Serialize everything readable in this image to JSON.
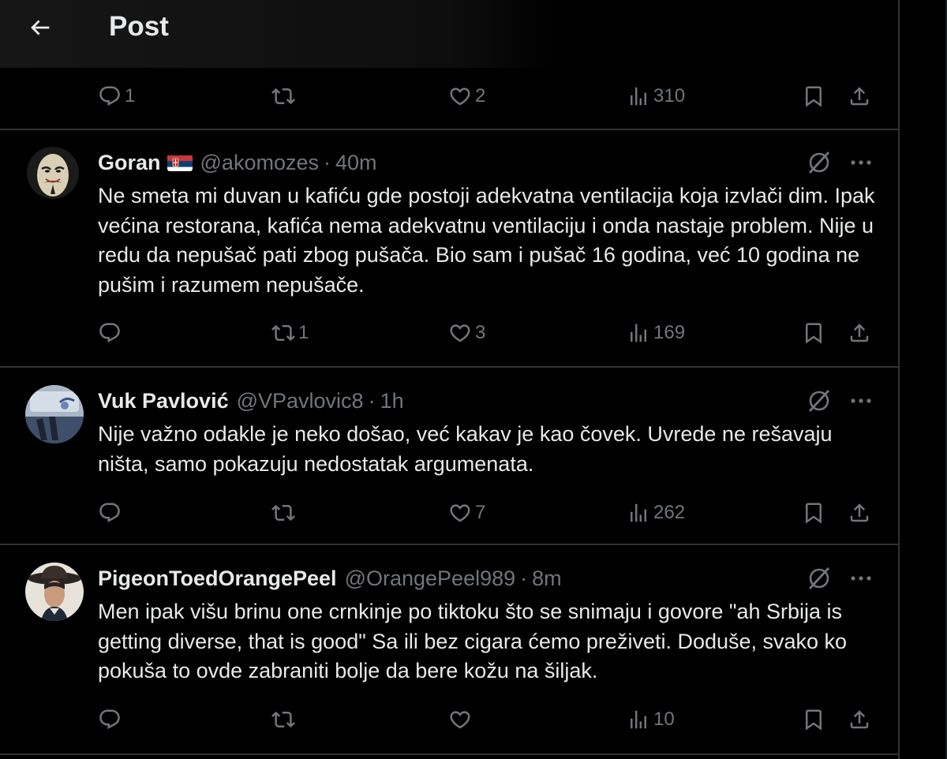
{
  "header": {
    "title": "Post",
    "back_icon": "arrow-left-icon"
  },
  "top_actions": {
    "replies": "1",
    "reposts": "",
    "likes": "2",
    "views": "310"
  },
  "posts": [
    {
      "name": "Goran",
      "has_flag": true,
      "handle": "@akomozes",
      "sep": "·",
      "time": "40m",
      "text": "Ne smeta mi duvan u kafiću gde postoji adekvatna ventilacija koja izvlači dim. Ipak većina restorana, kafića nema adekvatnu ventilaciju i onda nastaje problem. Nije u redu da nepušač pati zbog pušača. Bio sam i pušač 16 godina, već 10 godina ne pušim i razumem nepušače.",
      "replies": "",
      "reposts": "1",
      "likes": "3",
      "views": "169"
    },
    {
      "name": "Vuk Pavlović",
      "has_flag": false,
      "handle": "@VPavlovic8",
      "sep": "·",
      "time": "1h",
      "text": "Nije važno odakle je neko došao, već kakav je kao čovek. Uvrede ne rešavaju ništa, samo pokazuju nedostatak argumenata.",
      "replies": "",
      "reposts": "",
      "likes": "7",
      "views": "262"
    },
    {
      "name": "PigeonToedOrangePeel",
      "has_flag": false,
      "handle": "@OrangePeel989",
      "sep": "·",
      "time": "8m",
      "text": "Men ipak višu brinu one crnkinje po tiktoku što se snimaju i govore \"ah Srbija is getting diverse, that is good\" Sa ili bez cigara ćemo preživeti. Doduše, svako ko pokuša to ovde zabraniti bolje da bere kožu na šiljak.",
      "replies": "",
      "reposts": "",
      "likes": "",
      "views": "10"
    }
  ],
  "colors": {
    "background": "#000000",
    "text": "#e7e9ea",
    "muted": "#71767b",
    "divider": "#2f3336"
  }
}
